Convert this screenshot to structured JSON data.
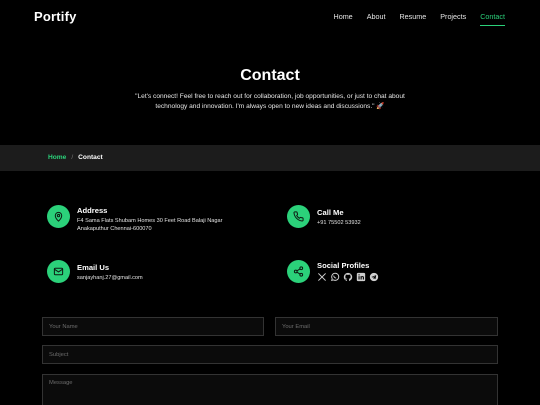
{
  "header": {
    "logo": "Portify",
    "nav": [
      {
        "label": "Home"
      },
      {
        "label": "About"
      },
      {
        "label": "Resume"
      },
      {
        "label": "Projects"
      },
      {
        "label": "Contact",
        "active": true
      }
    ]
  },
  "hero": {
    "title": "Contact",
    "text": "\"Let's connect! Feel free to reach out for collaboration, job opportunities, or just to chat about technology and innovation. I'm always open to new ideas and discussions.\"",
    "emoji": "🚀"
  },
  "breadcrumb": {
    "home": "Home",
    "separator": "/",
    "current": "Contact"
  },
  "contact_info": {
    "address": {
      "title": "Address",
      "line1": "F4 Sama Flats Shubam Homes 30 Feet Road Balaji Nagar",
      "line2": "Anakaputhur Chennai-600070",
      "icon": "map-pin-icon"
    },
    "call": {
      "title": "Call Me",
      "value": "+91 75502 53932",
      "icon": "phone-icon"
    },
    "email": {
      "title": "Email Us",
      "value": "sanjayhanj.27@gmail.com",
      "icon": "envelope-icon"
    },
    "social": {
      "title": "Social Profiles",
      "icons": [
        "x-twitter-icon",
        "whatsapp-icon",
        "github-icon",
        "linkedin-icon",
        "telegram-icon"
      ]
    }
  },
  "form": {
    "name_placeholder": "Your Name",
    "email_placeholder": "Your Email",
    "subject_placeholder": "Subject",
    "message_placeholder": "Message"
  },
  "colors": {
    "accent": "#2bd17a",
    "background": "#000000",
    "breadcrumb_bg": "#1c1c1c"
  }
}
